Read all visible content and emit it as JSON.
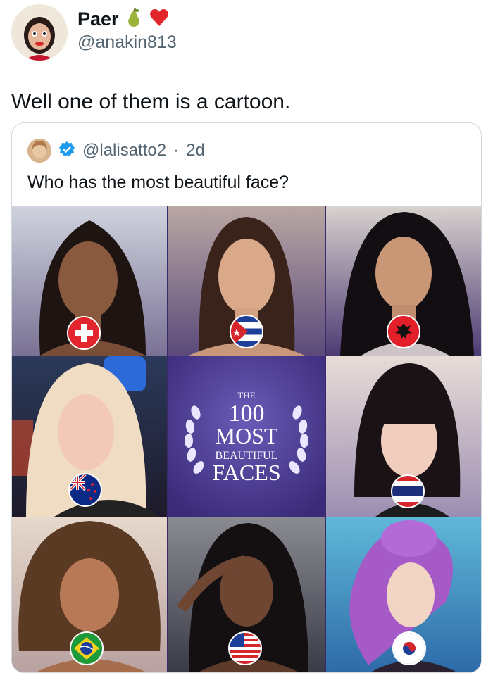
{
  "post": {
    "display_name": "Paer",
    "name_emojis": [
      "pear-icon",
      "heart-icon"
    ],
    "handle": "@anakin813",
    "text": "Well one of them is a cartoon."
  },
  "quote": {
    "handle": "@lalisatto2",
    "separator": "·",
    "time": "2d",
    "text": "Who has the most beautiful face?",
    "verified_color": "#1d9bf0"
  },
  "collage": {
    "badge_line1": "THE",
    "badge_line2": "100",
    "badge_line3": "MOST",
    "badge_line4": "BEAUTIFUL",
    "badge_line5": "FACES",
    "cells": [
      {
        "flag": "switzerland-flag-icon"
      },
      {
        "flag": "cuba-flag-icon"
      },
      {
        "flag": "albania-flag-icon"
      },
      {
        "flag": "new-zealand-flag-icon"
      },
      {
        "flag": "none"
      },
      {
        "flag": "thailand-flag-icon"
      },
      {
        "flag": "brazil-flag-icon"
      },
      {
        "flag": "usa-flag-icon"
      },
      {
        "flag": "south-korea-flag-icon"
      }
    ]
  }
}
